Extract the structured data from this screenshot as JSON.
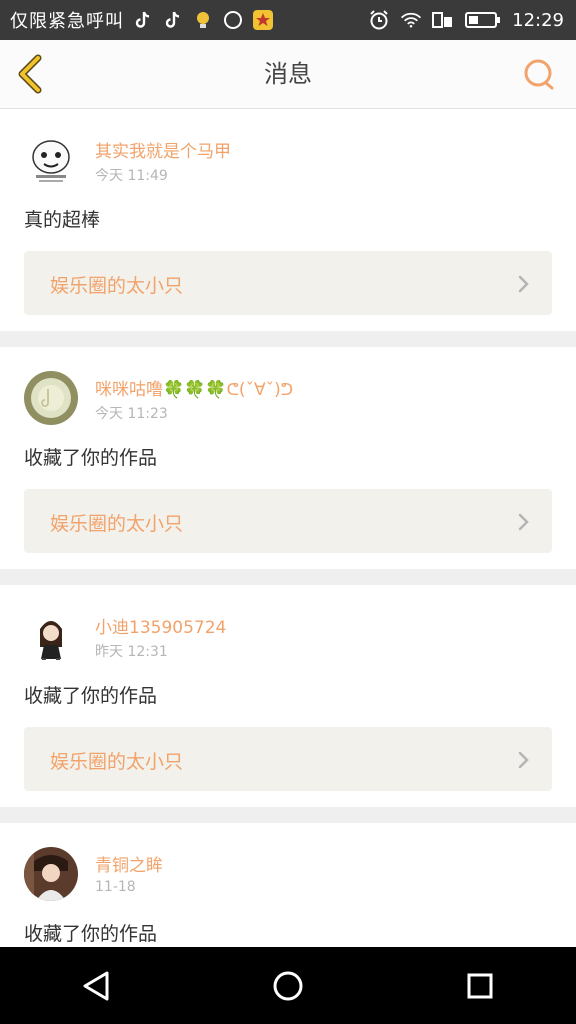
{
  "status_bar": {
    "carrier_text": "仅限紧急呼叫",
    "time": "12:29",
    "icons": [
      "tiktok-icon",
      "tiktok-icon",
      "bulb-icon",
      "compass-icon",
      "star-app-icon",
      "alarm-icon",
      "wifi-icon",
      "sim-icon",
      "battery-icon"
    ]
  },
  "header": {
    "title": "消息",
    "back_icon": "chevron-left-icon",
    "search_icon": "search-icon",
    "accent_color": "#f2a36b"
  },
  "messages": [
    {
      "user": "其实我就是个马甲",
      "time": "今天  11:49",
      "content": "真的超棒",
      "circle": "娱乐圈的太小只"
    },
    {
      "user": "咪咪咕噜🍀🍀🍀ᕦ(ˇ∀ˇ)ᕤ",
      "time": "今天  11:23",
      "content": "收藏了你的作品",
      "circle": "娱乐圈的太小只"
    },
    {
      "user": "小迪135905724",
      "time": "昨天  12:31",
      "content": "收藏了你的作品",
      "circle": "娱乐圈的太小只"
    },
    {
      "user": "青铜之眸",
      "time": "11-18",
      "content": "收藏了你的作品"
    }
  ],
  "nav_bar": {
    "icons": [
      "back-triangle-icon",
      "home-circle-icon",
      "recents-square-icon"
    ]
  }
}
